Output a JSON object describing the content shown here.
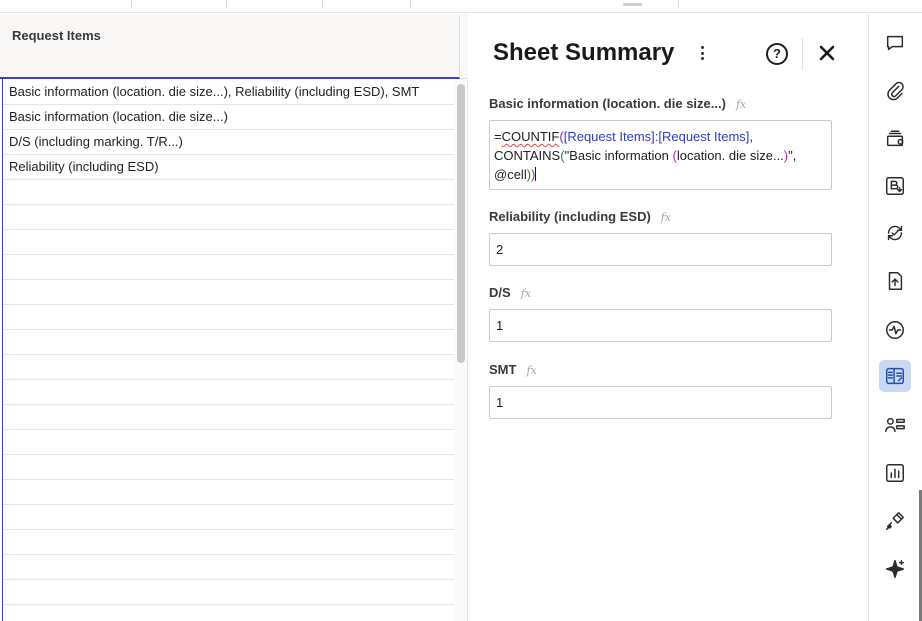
{
  "grid": {
    "column_header": "Request Items",
    "rows": [
      "Basic information (location. die size...), Reliability (including ESD), SMT",
      "Basic information (location. die size...)",
      "D/S (including marking. T/R...)",
      "Reliability (including ESD)",
      "",
      "",
      "",
      "",
      "",
      "",
      "",
      "",
      "",
      "",
      "",
      "",
      "",
      "",
      "",
      "",
      "",
      ""
    ]
  },
  "panel": {
    "title": "Sheet Summary",
    "help_label": "?",
    "fx_label": "fx",
    "fields": [
      {
        "label": "Basic information (location. die size...)",
        "formula_parts": [
          {
            "text": "=",
            "style": "black"
          },
          {
            "text": "COUNTIF",
            "style": "squiggle"
          },
          {
            "text": "(",
            "style": "purple"
          },
          {
            "text": "[Request Items]:[Request Items]",
            "style": "blue"
          },
          {
            "text": ", CONTAINS",
            "style": "black"
          },
          {
            "text": "(",
            "style": "green"
          },
          {
            "text": "\"Basic information ",
            "style": "black"
          },
          {
            "text": "(",
            "style": "magenta"
          },
          {
            "text": "location. die size...",
            "style": "black"
          },
          {
            "text": ")",
            "style": "magenta"
          },
          {
            "text": "\", @cell",
            "style": "black"
          },
          {
            "text": ")",
            "style": "green"
          },
          {
            "text": ")",
            "style": "purple"
          }
        ]
      },
      {
        "label": "Reliability (including ESD)",
        "value": "2"
      },
      {
        "label": "D/S",
        "value": "1"
      },
      {
        "label": "SMT",
        "value": "1"
      }
    ]
  },
  "rail": {
    "icons": [
      {
        "name": "comment-icon"
      },
      {
        "name": "attachment-icon"
      },
      {
        "name": "proofing-icon"
      },
      {
        "name": "brandfolder-icon"
      },
      {
        "name": "update-requests-icon"
      },
      {
        "name": "publish-icon"
      },
      {
        "name": "activity-log-icon"
      },
      {
        "name": "sheet-summary-icon",
        "active": true
      },
      {
        "name": "forms-icon"
      },
      {
        "name": "data-icon"
      },
      {
        "name": "connections-icon"
      },
      {
        "name": "ai-sparkle-icon"
      }
    ]
  },
  "colors": {
    "accent": "#3b3fd8",
    "rail_active": "#c9d8f3",
    "formula_range": "#2f3ec6"
  }
}
